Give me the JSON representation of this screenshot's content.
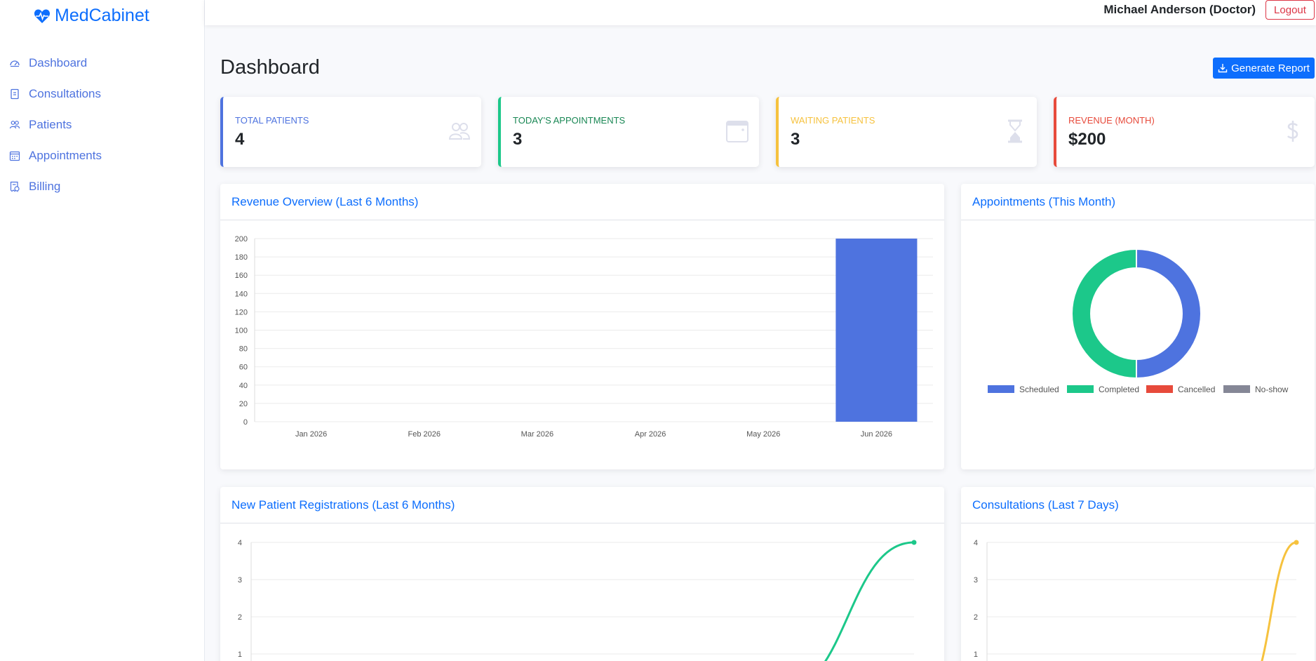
{
  "brand": {
    "name": "MedCabinet",
    "icon": "heart-pulse-icon",
    "color": "#0d6efd"
  },
  "sidebar": {
    "items": [
      {
        "label": "Dashboard",
        "icon": "speedometer-icon"
      },
      {
        "label": "Consultations",
        "icon": "clipboard-icon"
      },
      {
        "label": "Patients",
        "icon": "people-icon"
      },
      {
        "label": "Appointments",
        "icon": "calendar-icon"
      },
      {
        "label": "Billing",
        "icon": "receipt-icon"
      }
    ]
  },
  "header": {
    "user": "Michael Anderson (Doctor)",
    "logout": "Logout"
  },
  "page": {
    "title": "Dashboard",
    "report_button": "Generate Report"
  },
  "stats": [
    {
      "label": "Total Patients",
      "value": "4",
      "color": "#4e73df",
      "icon": "people-icon"
    },
    {
      "label": "Today's Appointments",
      "value": "3",
      "color": "#1cc88a",
      "icon": "calendar-icon"
    },
    {
      "label": "Waiting Patients",
      "value": "3",
      "color": "#f6c23e",
      "icon": "hourglass-icon"
    },
    {
      "label": "Revenue (Month)",
      "value": "$200",
      "color": "#e74a3b",
      "icon": "dollar-icon"
    }
  ],
  "cards": {
    "revenue": "Revenue Overview (Last 6 Months)",
    "appointments": "Appointments (This Month)",
    "registrations": "New Patient Registrations (Last 6 Months)",
    "consultations": "Consultations (Last 7 Days)"
  },
  "chart_data": [
    {
      "type": "bar",
      "title": "Revenue Overview (Last 6 Months)",
      "categories": [
        "Jan 2026",
        "Feb 2026",
        "Mar 2026",
        "Apr 2026",
        "May 2026",
        "Jun 2026"
      ],
      "values": [
        0,
        0,
        0,
        0,
        0,
        200
      ],
      "ylim": [
        0,
        200
      ],
      "yticks": [
        0,
        20,
        40,
        60,
        80,
        100,
        120,
        140,
        160,
        180,
        200
      ],
      "color": "#4e73df",
      "grid": true
    },
    {
      "type": "pie",
      "title": "Appointments (This Month)",
      "labels": [
        "Scheduled",
        "Completed",
        "Cancelled",
        "No-show"
      ],
      "values": [
        1,
        1,
        0,
        0
      ],
      "colors": [
        "#4e73df",
        "#1cc88a",
        "#e74a3b",
        "#858796"
      ],
      "legend": "bottom"
    },
    {
      "type": "line",
      "title": "New Patient Registrations (Last 6 Months)",
      "values": [
        0,
        0,
        0,
        0,
        0,
        4
      ],
      "ylim": [
        0,
        4
      ],
      "yticks": [
        1,
        2,
        3,
        4
      ],
      "color": "#1cc88a",
      "grid": true
    },
    {
      "type": "line",
      "title": "Consultations (Last 7 Days)",
      "values": [
        0,
        0,
        0,
        0,
        0,
        0,
        4
      ],
      "ylim": [
        0,
        4
      ],
      "yticks": [
        1,
        2,
        3,
        4
      ],
      "color": "#f6c23e",
      "grid": true
    }
  ]
}
